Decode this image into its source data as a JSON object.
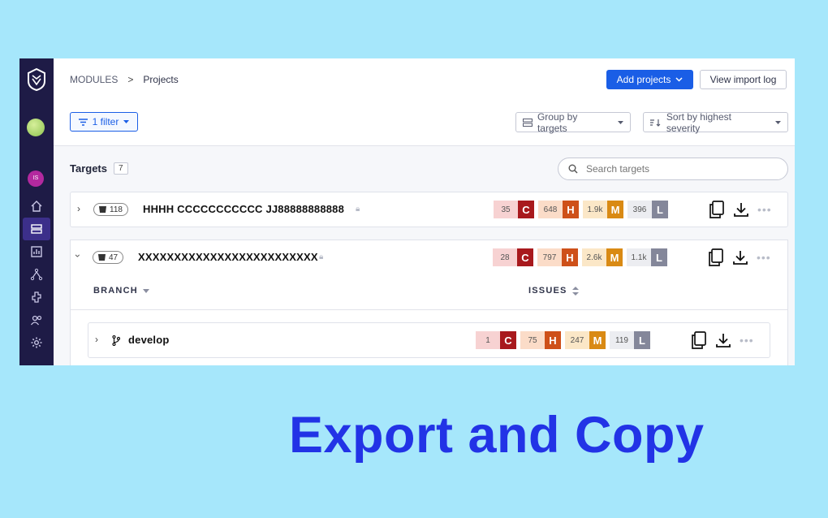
{
  "breadcrumb": {
    "module": "MODULES",
    "sep": ">",
    "current": "Projects"
  },
  "header": {
    "add_projects": "Add projects",
    "view_import_log": "View import log"
  },
  "sidebar": {
    "user_initials": "IS"
  },
  "filters": {
    "filter_label": "1 filter",
    "group_by": "Group by targets",
    "sort_by": "Sort by highest severity"
  },
  "targets": {
    "label": "Targets",
    "count": "7",
    "search_placeholder": "Search targets"
  },
  "severity_colors": {
    "C": "#a8191d",
    "H": "#ce5019",
    "M": "#d98a14",
    "L": "#84879a"
  },
  "rows": [
    {
      "badge": "118",
      "name": "HHHH CCCCCCCCCCC JJ88888888888",
      "sev": {
        "C": "35",
        "H": "648",
        "M": "1.9k",
        "L": "396"
      }
    },
    {
      "badge": "47",
      "name": "XXXXXXXXXXXXXXXXXXXXXXXXX",
      "sev": {
        "C": "28",
        "H": "797",
        "M": "2.6k",
        "L": "1.1k"
      }
    }
  ],
  "branch_table": {
    "branch_header": "BRANCH",
    "issues_header": "ISSUES"
  },
  "branch_row": {
    "name": "develop",
    "sev": {
      "C": "1",
      "H": "75",
      "M": "247",
      "L": "119"
    }
  },
  "sev_letters": {
    "C": "C",
    "H": "H",
    "M": "M",
    "L": "L"
  },
  "headline": "Export and Copy"
}
